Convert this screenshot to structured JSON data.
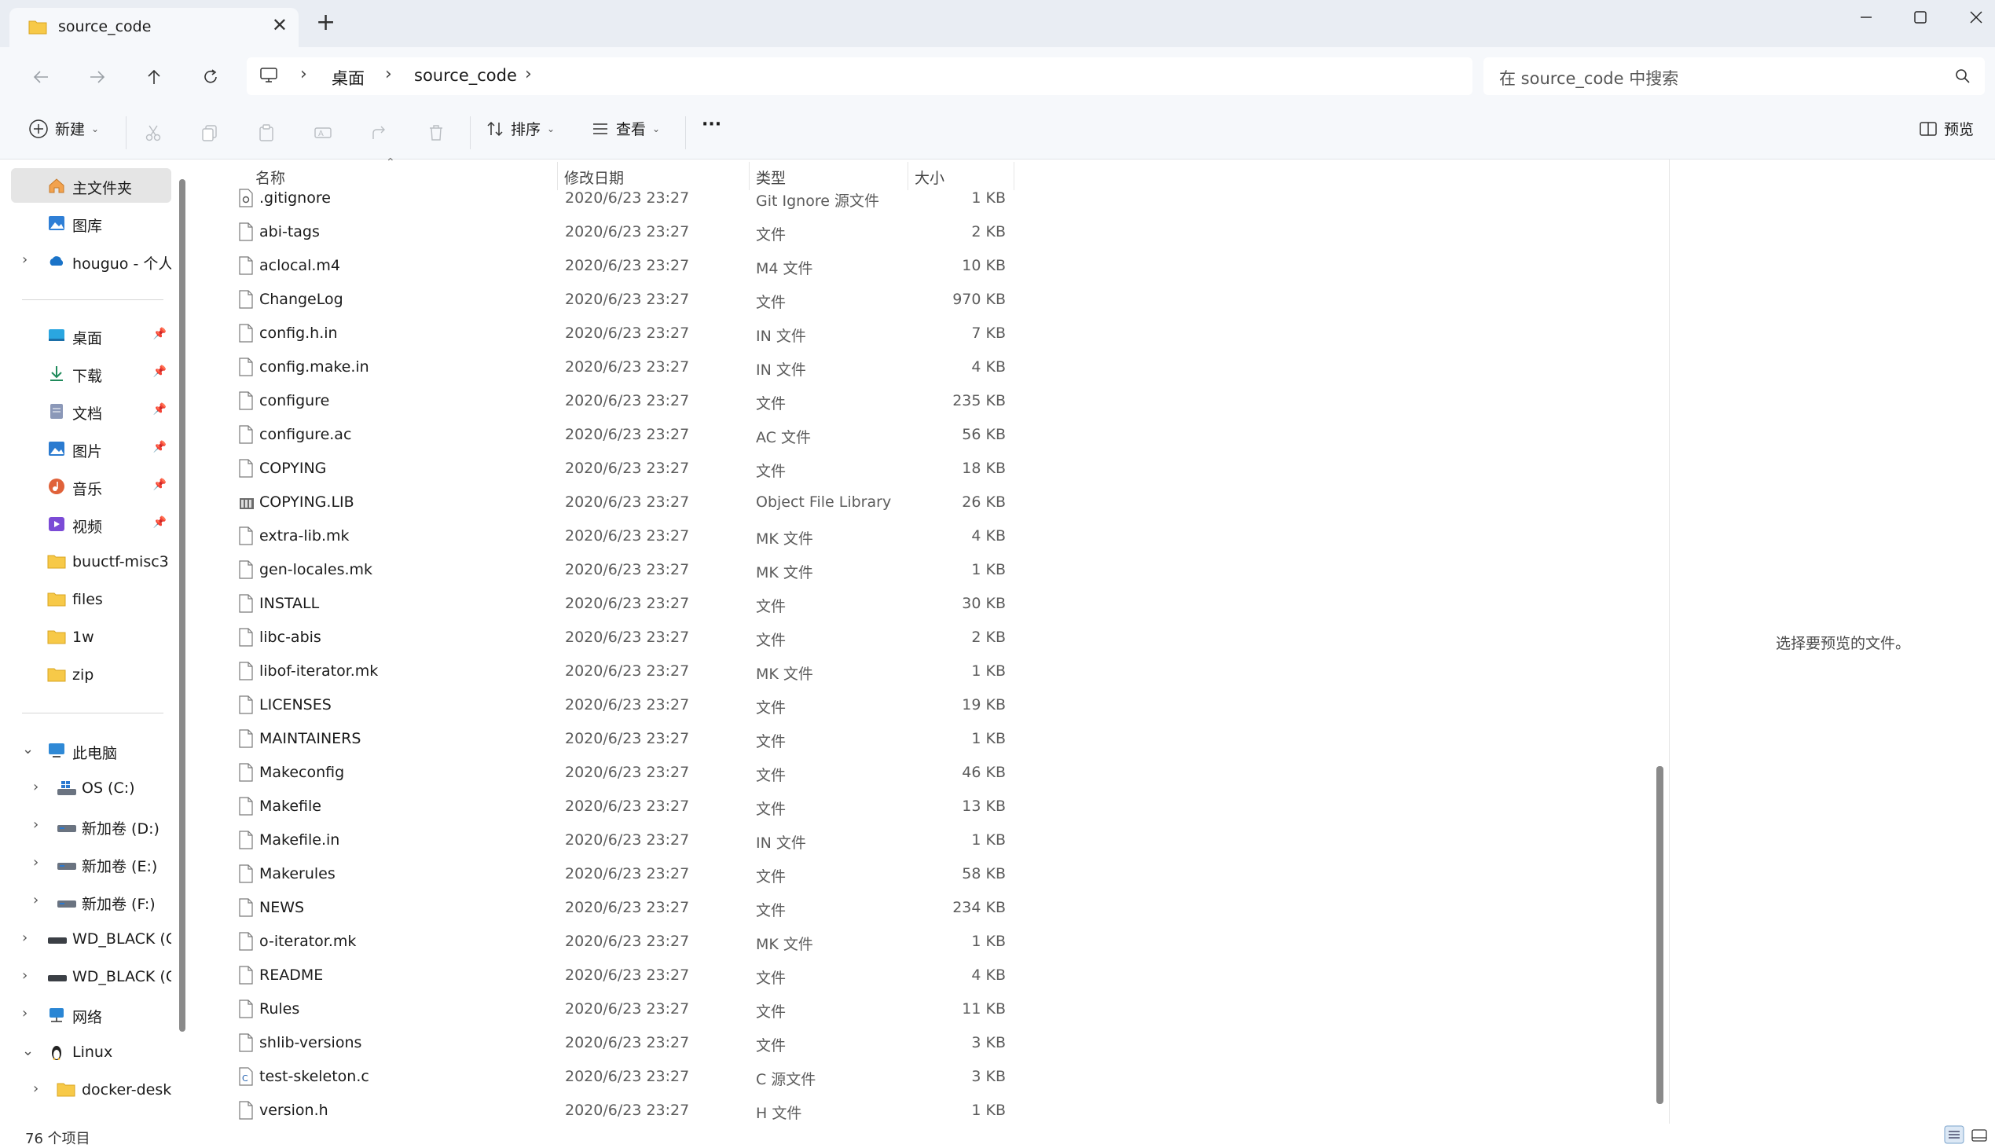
{
  "tab": {
    "title": "source_code",
    "close_glyph": "✕",
    "new_tab_glyph": "+"
  },
  "address": {
    "crumbs": [
      "桌面",
      "source_code"
    ]
  },
  "search": {
    "placeholder": "在 source_code 中搜索"
  },
  "toolbar": {
    "new_label": "新建",
    "sort_label": "排序",
    "view_label": "查看",
    "more_glyph": "···",
    "preview_label": "预览"
  },
  "columns": {
    "select_all": "",
    "name": "名称",
    "date": "修改日期",
    "type": "类型",
    "size": "大小"
  },
  "sidebar": {
    "items": [
      {
        "label": "主文件夹",
        "icon": "home-icon",
        "pinned": false,
        "selected": true
      },
      {
        "label": "图库",
        "icon": "gallery-icon",
        "pinned": false
      },
      {
        "label": "houguo - 个人",
        "icon": "onedrive-cloud-icon",
        "pinned": false,
        "expandable": true
      },
      {
        "label": "桌面",
        "icon": "desktop-icon",
        "pinned": true
      },
      {
        "label": "下载",
        "icon": "download-icon",
        "pinned": true
      },
      {
        "label": "文档",
        "icon": "documents-icon",
        "pinned": true
      },
      {
        "label": "图片",
        "icon": "pictures-icon",
        "pinned": true
      },
      {
        "label": "音乐",
        "icon": "music-icon",
        "pinned": true
      },
      {
        "label": "视频",
        "icon": "videos-icon",
        "pinned": true
      },
      {
        "label": "buuctf-misc3",
        "icon": "folder-icon"
      },
      {
        "label": "files",
        "icon": "folder-icon"
      },
      {
        "label": "1w",
        "icon": "folder-icon"
      },
      {
        "label": "zip",
        "icon": "folder-icon"
      },
      {
        "label": "此电脑",
        "icon": "computer-icon",
        "expanded": true
      },
      {
        "label": "OS (C:)",
        "icon": "windows-drive-icon"
      },
      {
        "label": "新加卷 (D:)",
        "icon": "drive-icon"
      },
      {
        "label": "新加卷 (E:)",
        "icon": "drive-icon"
      },
      {
        "label": "新加卷 (F:)",
        "icon": "drive-icon"
      },
      {
        "label": "WD_BLACK (G:)",
        "icon": "external-drive-icon"
      },
      {
        "label": "WD_BLACK (G:)",
        "icon": "external-drive-icon"
      },
      {
        "label": "网络",
        "icon": "network-icon"
      },
      {
        "label": "Linux",
        "icon": "linux-penguin-icon",
        "expanded": true
      },
      {
        "label": "docker-desktop",
        "icon": "folder-icon"
      }
    ]
  },
  "files": [
    {
      "name": ".gitignore",
      "date": "2020/6/23 23:27",
      "type": "Git Ignore 源文件",
      "size": "1 KB",
      "icon": "gear-file-icon"
    },
    {
      "name": "abi-tags",
      "date": "2020/6/23 23:27",
      "type": "文件",
      "size": "2 KB",
      "icon": "file-icon"
    },
    {
      "name": "aclocal.m4",
      "date": "2020/6/23 23:27",
      "type": "M4 文件",
      "size": "10 KB",
      "icon": "file-icon"
    },
    {
      "name": "ChangeLog",
      "date": "2020/6/23 23:27",
      "type": "文件",
      "size": "970 KB",
      "icon": "file-icon"
    },
    {
      "name": "config.h.in",
      "date": "2020/6/23 23:27",
      "type": "IN 文件",
      "size": "7 KB",
      "icon": "file-icon"
    },
    {
      "name": "config.make.in",
      "date": "2020/6/23 23:27",
      "type": "IN 文件",
      "size": "4 KB",
      "icon": "file-icon"
    },
    {
      "name": "configure",
      "date": "2020/6/23 23:27",
      "type": "文件",
      "size": "235 KB",
      "icon": "file-icon"
    },
    {
      "name": "configure.ac",
      "date": "2020/6/23 23:27",
      "type": "AC 文件",
      "size": "56 KB",
      "icon": "file-icon"
    },
    {
      "name": "COPYING",
      "date": "2020/6/23 23:27",
      "type": "文件",
      "size": "18 KB",
      "icon": "file-icon"
    },
    {
      "name": "COPYING.LIB",
      "date": "2020/6/23 23:27",
      "type": "Object File Library",
      "size": "26 KB",
      "icon": "library-file-icon"
    },
    {
      "name": "extra-lib.mk",
      "date": "2020/6/23 23:27",
      "type": "MK 文件",
      "size": "4 KB",
      "icon": "file-icon"
    },
    {
      "name": "gen-locales.mk",
      "date": "2020/6/23 23:27",
      "type": "MK 文件",
      "size": "1 KB",
      "icon": "file-icon"
    },
    {
      "name": "INSTALL",
      "date": "2020/6/23 23:27",
      "type": "文件",
      "size": "30 KB",
      "icon": "file-icon"
    },
    {
      "name": "libc-abis",
      "date": "2020/6/23 23:27",
      "type": "文件",
      "size": "2 KB",
      "icon": "file-icon"
    },
    {
      "name": "libof-iterator.mk",
      "date": "2020/6/23 23:27",
      "type": "MK 文件",
      "size": "1 KB",
      "icon": "file-icon"
    },
    {
      "name": "LICENSES",
      "date": "2020/6/23 23:27",
      "type": "文件",
      "size": "19 KB",
      "icon": "file-icon"
    },
    {
      "name": "MAINTAINERS",
      "date": "2020/6/23 23:27",
      "type": "文件",
      "size": "1 KB",
      "icon": "file-icon"
    },
    {
      "name": "Makeconfig",
      "date": "2020/6/23 23:27",
      "type": "文件",
      "size": "46 KB",
      "icon": "file-icon"
    },
    {
      "name": "Makefile",
      "date": "2020/6/23 23:27",
      "type": "文件",
      "size": "13 KB",
      "icon": "file-icon"
    },
    {
      "name": "Makefile.in",
      "date": "2020/6/23 23:27",
      "type": "IN 文件",
      "size": "1 KB",
      "icon": "file-icon"
    },
    {
      "name": "Makerules",
      "date": "2020/6/23 23:27",
      "type": "文件",
      "size": "58 KB",
      "icon": "file-icon"
    },
    {
      "name": "NEWS",
      "date": "2020/6/23 23:27",
      "type": "文件",
      "size": "234 KB",
      "icon": "file-icon"
    },
    {
      "name": "o-iterator.mk",
      "date": "2020/6/23 23:27",
      "type": "MK 文件",
      "size": "1 KB",
      "icon": "file-icon"
    },
    {
      "name": "README",
      "date": "2020/6/23 23:27",
      "type": "文件",
      "size": "4 KB",
      "icon": "file-icon"
    },
    {
      "name": "Rules",
      "date": "2020/6/23 23:27",
      "type": "文件",
      "size": "11 KB",
      "icon": "file-icon"
    },
    {
      "name": "shlib-versions",
      "date": "2020/6/23 23:27",
      "type": "文件",
      "size": "3 KB",
      "icon": "file-icon"
    },
    {
      "name": "test-skeleton.c",
      "date": "2020/6/23 23:27",
      "type": "C 源文件",
      "size": "3 KB",
      "icon": "c-source-file-icon"
    },
    {
      "name": "version.h",
      "date": "2020/6/23 23:27",
      "type": "H 文件",
      "size": "1 KB",
      "icon": "file-icon"
    }
  ],
  "preview": {
    "empty_text": "选择要预览的文件。"
  },
  "status": {
    "item_count": "76 个项目"
  },
  "colors": {
    "accent": "#0067c0",
    "selected_bg": "#e5e5e5",
    "folder": "#f7c948"
  }
}
